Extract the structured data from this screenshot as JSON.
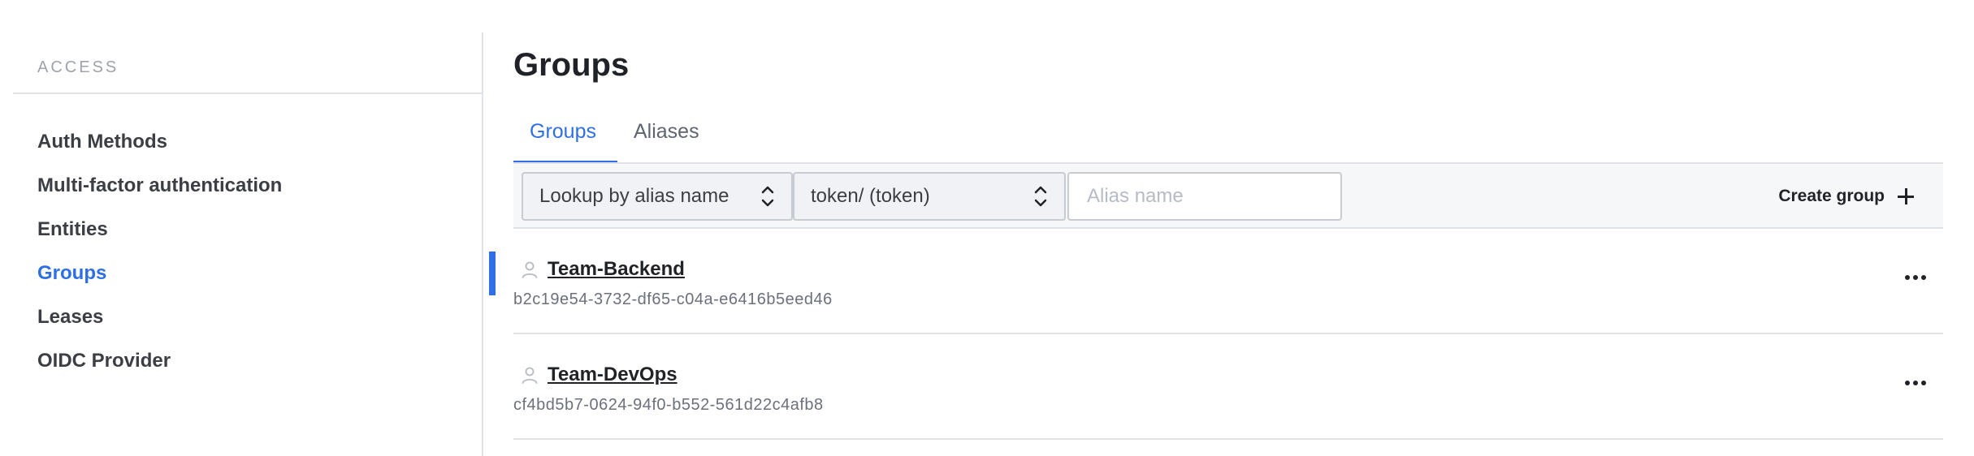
{
  "sidebar": {
    "heading": "ACCESS",
    "items": [
      {
        "label": "Auth Methods",
        "active": false
      },
      {
        "label": "Multi-factor authentication",
        "active": false
      },
      {
        "label": "Entities",
        "active": false
      },
      {
        "label": "Groups",
        "active": true
      },
      {
        "label": "Leases",
        "active": false
      },
      {
        "label": "OIDC Provider",
        "active": false
      }
    ]
  },
  "main": {
    "title": "Groups",
    "tabs": [
      {
        "label": "Groups",
        "active": true
      },
      {
        "label": "Aliases",
        "active": false
      }
    ],
    "toolbar": {
      "lookup_select": "Lookup by alias name",
      "mount_select": "token/ (token)",
      "alias_placeholder": "Alias name",
      "alias_value": "",
      "create_label": "Create group"
    },
    "groups": [
      {
        "name": "Team-Backend",
        "id": "b2c19e54-3732-df65-c04a-e6416b5eed46"
      },
      {
        "name": "Team-DevOps",
        "id": "cf4bd5b7-0624-94f0-b552-561d22c4afb8"
      }
    ]
  },
  "colors": {
    "accent": "#2f6fe4",
    "text": "#1f2328",
    "muted": "#6a717c",
    "border": "#dfe2e6"
  },
  "icons": {
    "select_chevron": "chevron-up-down-icon",
    "create": "plus-icon",
    "group_row": "user-icon",
    "row_menu": "more-horizontal-icon"
  }
}
